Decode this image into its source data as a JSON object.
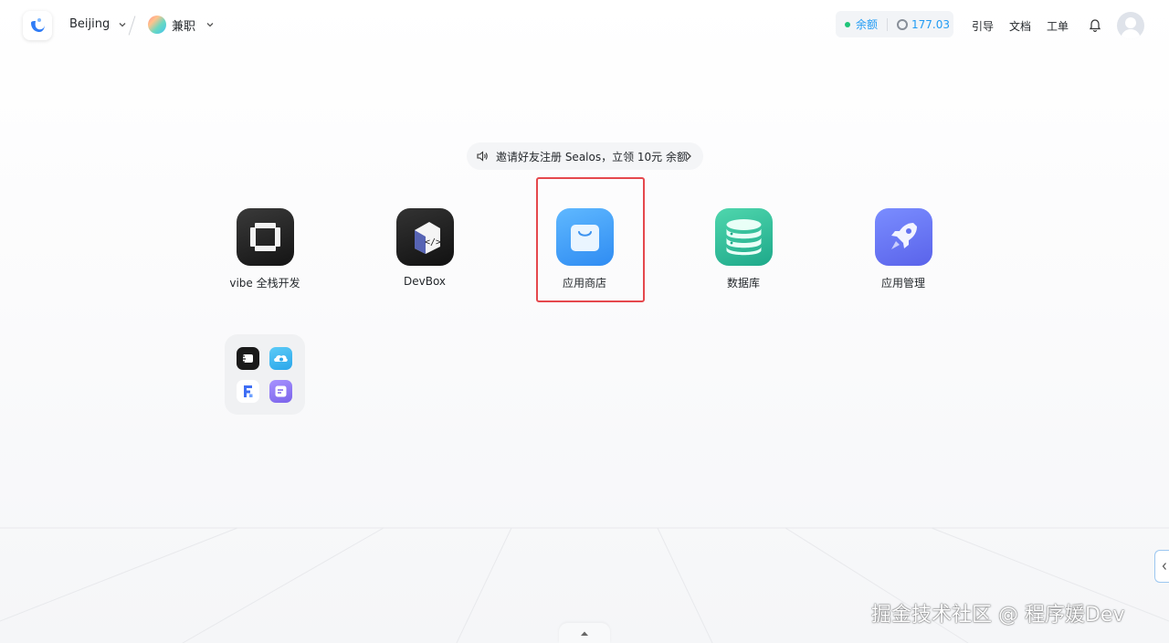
{
  "header": {
    "region": "Beijing",
    "workspace": "兼职",
    "balance_label": "余额",
    "balance_amount": "177.03",
    "nav": [
      "引导",
      "文档",
      "工单"
    ]
  },
  "announcement": {
    "text": "邀请好友注册 Sealos，立领 10元 余额"
  },
  "apps": [
    {
      "name": "vibe 全栈开发",
      "icon": "vibe-icon"
    },
    {
      "name": "DevBox",
      "icon": "devbox-icon"
    },
    {
      "name": "应用商店",
      "icon": "app-store-icon"
    },
    {
      "name": "数据库",
      "icon": "database-icon"
    },
    {
      "name": "应用管理",
      "icon": "rocket-icon"
    }
  ],
  "highlighted_app": "应用商店",
  "colors": {
    "accent": "#219bf4",
    "status_green": "#1fc479",
    "highlight_red": "#e5484d"
  },
  "watermark": "掘金技术社区 @ 程序媛Dev"
}
